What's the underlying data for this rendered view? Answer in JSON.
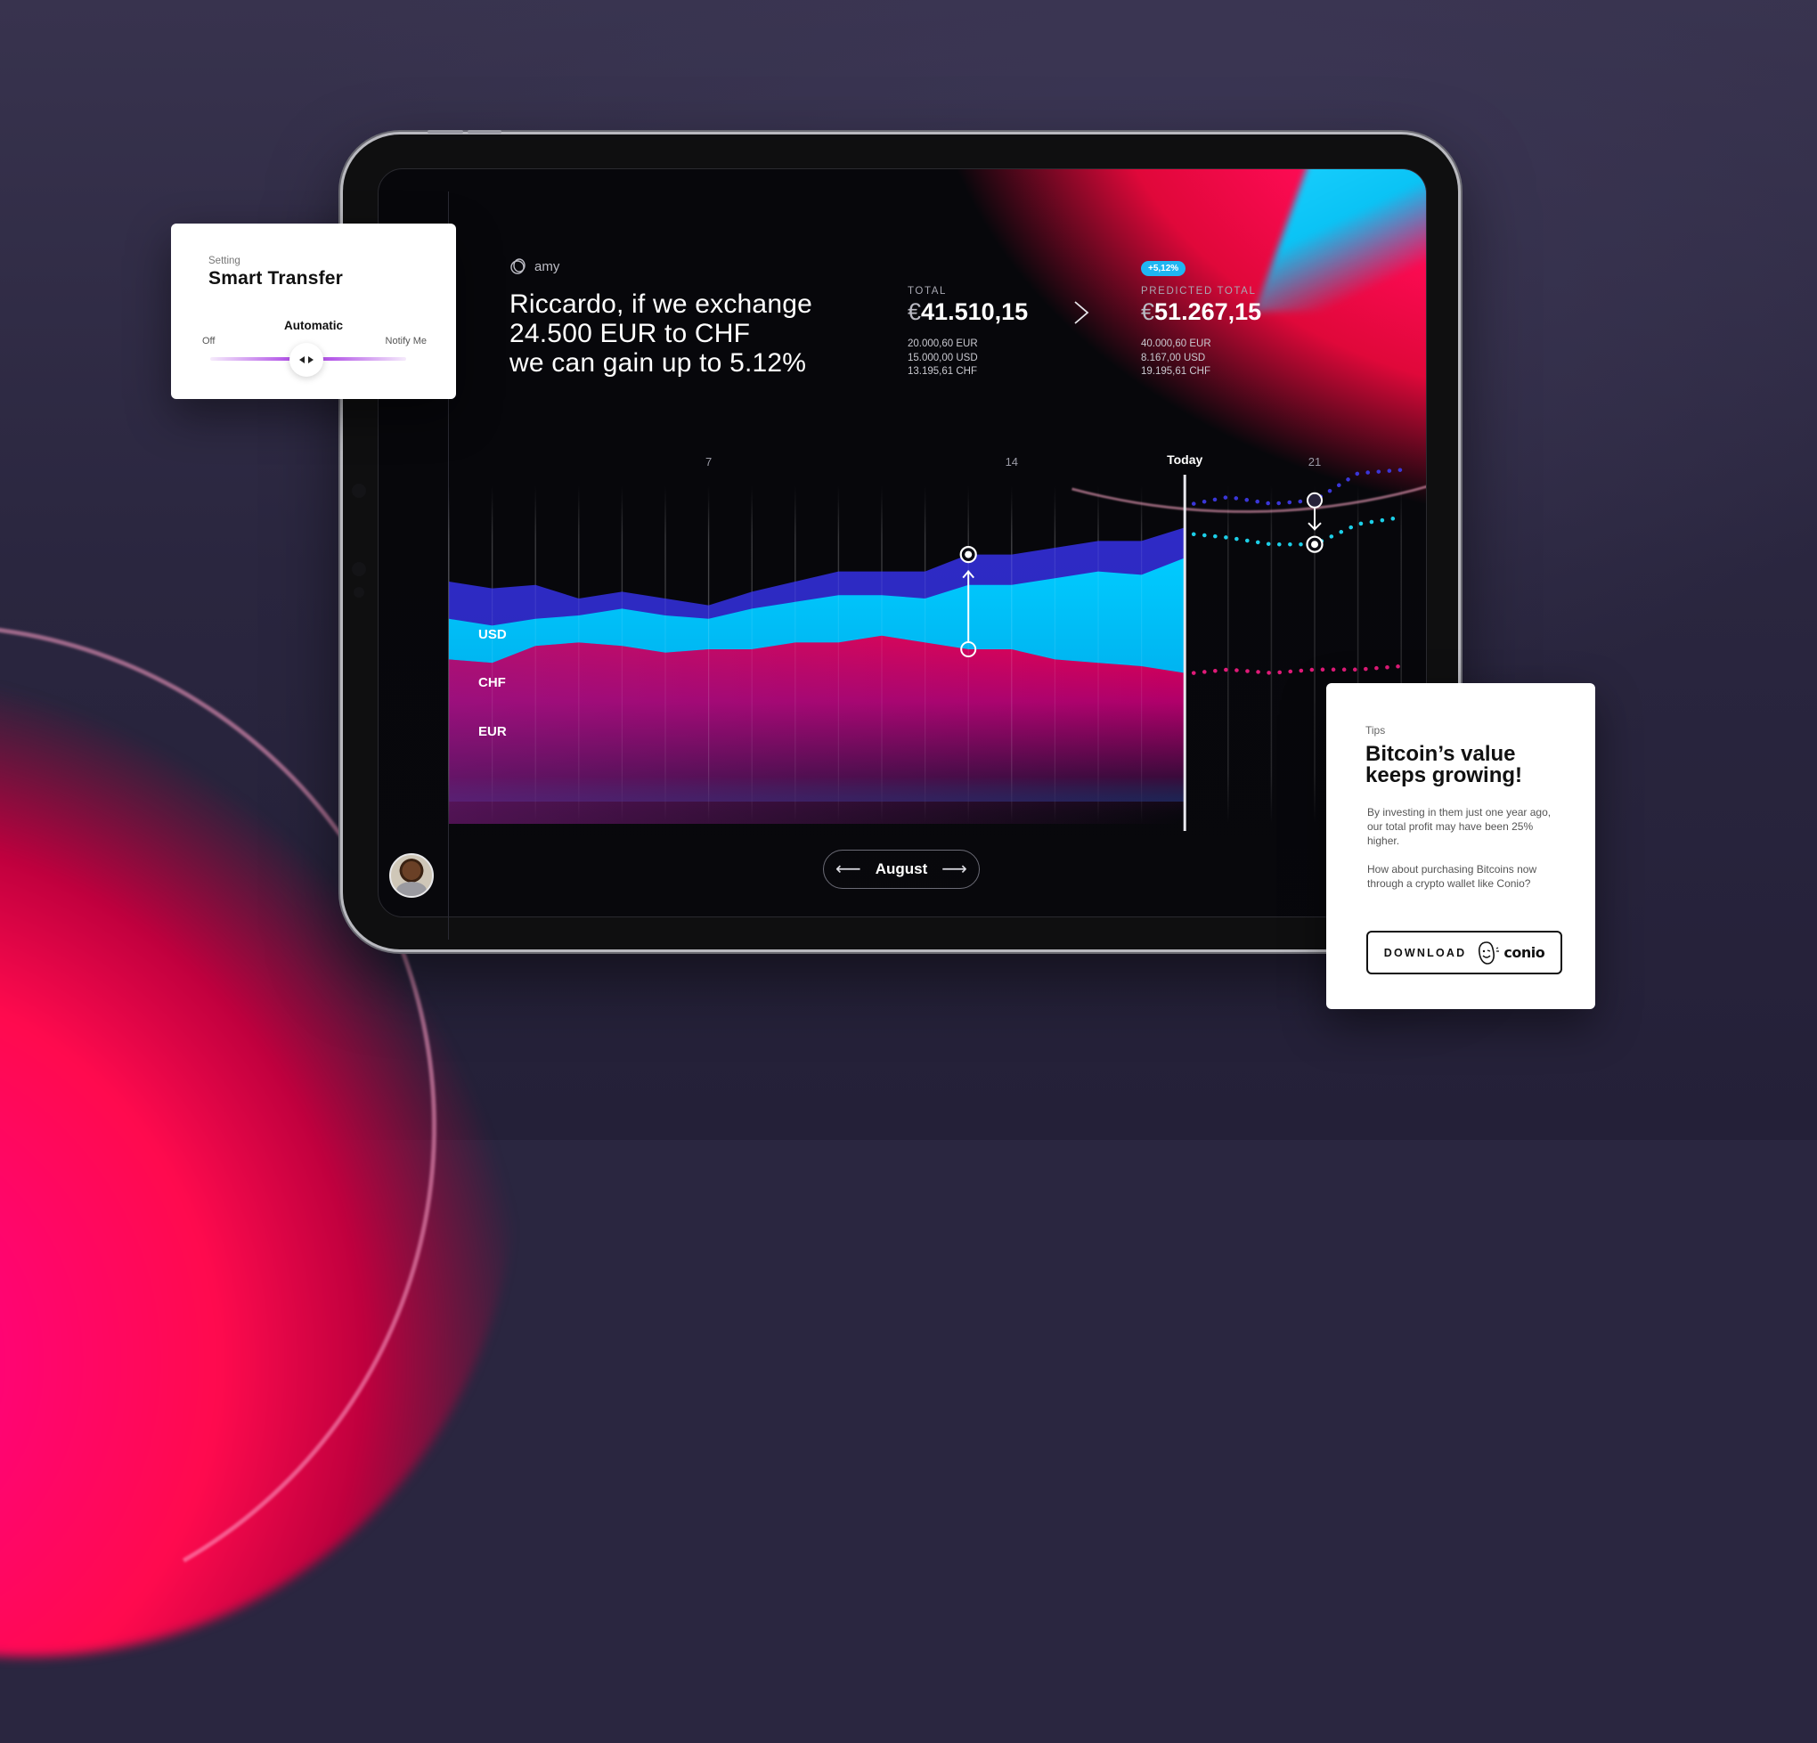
{
  "app": {
    "brand": "amy",
    "brand_icon": "rings-logo-icon"
  },
  "headline": {
    "line1": "Riccardo, if we exchange",
    "line2": "24.500 EUR to CHF",
    "line3": "we can gain up to 5.12%"
  },
  "total": {
    "label": "TOTAL",
    "currency_symbol": "€",
    "value": "41.510,15",
    "breakdown": [
      "20.000,60 EUR",
      "15.000,00 USD",
      "13.195,61 CHF"
    ]
  },
  "predicted": {
    "badge": "+5,12%",
    "label": "PREDICTED TOTAL",
    "currency_symbol": "€",
    "value": "51.267,15",
    "breakdown": [
      "40.000,60 EUR",
      "8.167,00 USD",
      "19.195,61 CHF"
    ]
  },
  "month_nav": {
    "label": "August",
    "prev_icon": "arrow-left-icon",
    "next_icon": "arrow-right-icon"
  },
  "smart_transfer": {
    "overline": "Setting",
    "title": "Smart Transfer",
    "selected_mode": "Automatic",
    "left_option": "Off",
    "right_option": "Notify Me",
    "slider_position": 0.5
  },
  "tips": {
    "overline": "Tips",
    "title": "Bitcoin’s value keeps growing!",
    "paragraph1": "By investing in them just one year ago, our total profit may have been 25% higher.",
    "paragraph2": "How about purchasing Bitcoins now through a crypto wallet like Conio?",
    "button_label": "DOWNLOAD",
    "partner": "conio"
  },
  "colors": {
    "usd": "#2a2ac4",
    "chf": "#00c8ff",
    "eur": "#e0005a",
    "badge": "#1fb6f2",
    "accent_purple": "#b55ae8"
  },
  "chart_data": {
    "type": "area",
    "stacked": true,
    "title": "",
    "xlabel": "",
    "ylabel": "",
    "x_ticks": [
      {
        "day": 7,
        "label": "7"
      },
      {
        "day": 14,
        "label": "14"
      },
      {
        "day": 18,
        "label": "Today",
        "highlight": true
      },
      {
        "day": 21,
        "label": "21"
      }
    ],
    "x": [
      1,
      2,
      3,
      4,
      5,
      6,
      7,
      8,
      9,
      10,
      11,
      12,
      13,
      14,
      15,
      16,
      17,
      18
    ],
    "xlim": [
      1,
      23
    ],
    "ylim": [
      0,
      100
    ],
    "series": [
      {
        "name": "EUR",
        "color": "#e0005a",
        "values": [
          42,
          41,
          46,
          47,
          46,
          44,
          45,
          45,
          47,
          47,
          49,
          47,
          45,
          45,
          42,
          41,
          40,
          38
        ]
      },
      {
        "name": "CHF",
        "color": "#00c8ff",
        "values": [
          12,
          11,
          8,
          8,
          11,
          11,
          9,
          12,
          12,
          14,
          12,
          13,
          19,
          19,
          24,
          27,
          27,
          34
        ]
      },
      {
        "name": "USD",
        "color": "#2a2ac4",
        "values": [
          11,
          11,
          10,
          5,
          5,
          5,
          4,
          5,
          6,
          7,
          7,
          8,
          9,
          9,
          9,
          9,
          10,
          9
        ]
      }
    ],
    "forecast": {
      "x": [
        18,
        19,
        20,
        21,
        22,
        23
      ],
      "series": [
        {
          "name": "USD",
          "style": "dotted",
          "values": [
            88,
            90,
            88,
            89,
            97,
            98
          ]
        },
        {
          "name": "CHF",
          "style": "dotted",
          "values": [
            79,
            78,
            76,
            76,
            82,
            84
          ]
        },
        {
          "name": "EUR",
          "style": "dotted",
          "values": [
            38,
            39,
            38,
            39,
            39,
            40
          ]
        }
      ]
    },
    "annotations": [
      {
        "type": "arrow-up",
        "day": 13,
        "from_series": "EUR",
        "to_series": "USD"
      },
      {
        "type": "arrow-down",
        "day": 21,
        "from_series": "USD",
        "to_series": "CHF"
      }
    ],
    "legend": "inline-left"
  }
}
